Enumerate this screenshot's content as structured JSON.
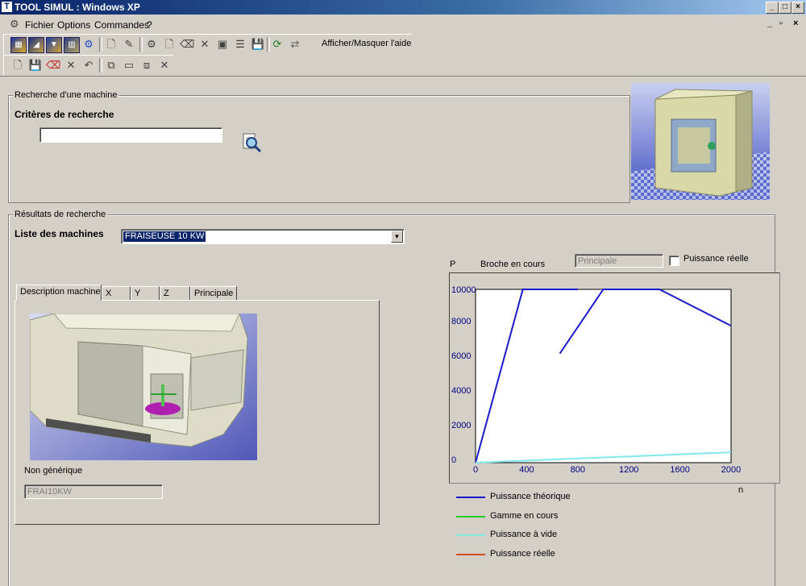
{
  "window": {
    "title": "TOOL SIMUL : Windows XP"
  },
  "menu": {
    "fichier": "Fichier",
    "options": "Options",
    "commandes": "Commandes",
    "help": "?"
  },
  "toolbar": {
    "help_toggle": "Afficher/Masquer l'aide"
  },
  "search": {
    "group_label": "Recherche d'une machine",
    "criteria_label": "Critères de recherche",
    "input_value": ""
  },
  "results": {
    "group_label": "Résultats de recherche",
    "machine_list_label": "Liste des machines",
    "selected_machine": "FRAISEUSE 10 KW"
  },
  "tabs": [
    "Description machine",
    "X",
    "Y",
    "Z",
    "Principale"
  ],
  "description": {
    "generic_label": "Non générique",
    "code_value": "FRAI10KW"
  },
  "chart_controls": {
    "spindle_field": "Principale",
    "real_power_checkbox_label": "Puissance réelle",
    "real_power_checked": false
  },
  "chart_data": {
    "type": "line",
    "ylabel": "P",
    "title": "Broche en cours",
    "xlabel": "n",
    "xlim": [
      0,
      2000
    ],
    "ylim": [
      0,
      10000
    ],
    "xticks": [
      0,
      400,
      800,
      1200,
      1600,
      2000
    ],
    "yticks": [
      0,
      2000,
      4000,
      6000,
      8000,
      10000
    ],
    "series": [
      {
        "name": "Puissance théorique",
        "color": "#1a1acd",
        "segments": [
          [
            [
              0,
              0
            ],
            [
              370,
              10000
            ],
            [
              800,
              10000
            ]
          ],
          [
            [
              660,
              6300
            ],
            [
              1000,
              10000
            ],
            [
              1440,
              10000
            ],
            [
              2000,
              7900
            ]
          ]
        ]
      },
      {
        "name": "Gamme en cours",
        "color": "#22cc22",
        "segments": []
      },
      {
        "name": "Puissance à vide",
        "color": "#80e8e8",
        "segments": [
          [
            [
              0,
              0
            ],
            [
              500,
              150
            ],
            [
              1000,
              300
            ],
            [
              1500,
              450
            ],
            [
              2000,
              600
            ]
          ]
        ]
      },
      {
        "name": "Puissance réelle",
        "color": "#d24a1e",
        "segments": []
      }
    ]
  }
}
